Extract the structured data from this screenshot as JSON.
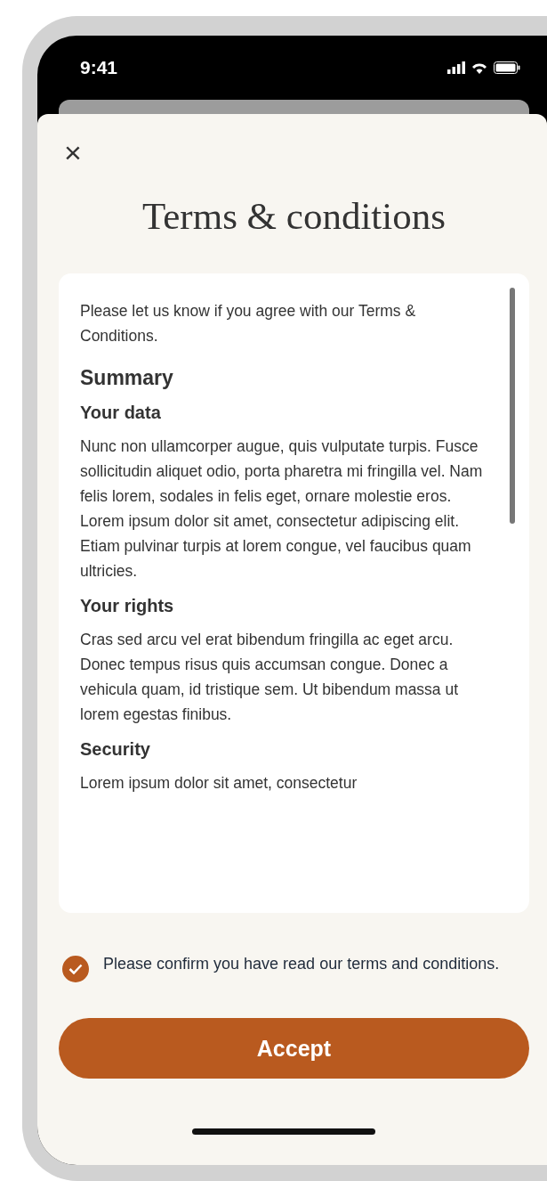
{
  "status_bar": {
    "time": "9:41"
  },
  "sheet": {
    "close": "×",
    "title": "Terms & conditions"
  },
  "terms": {
    "intro": "Please let us know if you agree with our Terms & Conditions.",
    "heading": "Summary",
    "sections": [
      {
        "title": "Your data",
        "paragraphs": [
          "Nunc non ullamcorper augue, quis vulputate turpis.  Fusce sollicitudin aliquet odio, porta pharetra mi fringilla vel. Nam felis lorem, sodales in felis eget, ornare molestie eros.",
          "Lorem ipsum dolor sit amet, consectetur adipiscing elit. Etiam pulvinar turpis at lorem congue, vel faucibus quam ultricies."
        ]
      },
      {
        "title": "Your rights",
        "paragraphs": [
          "Cras sed arcu vel erat bibendum fringilla ac eget arcu. Donec tempus risus quis accumsan congue. Donec a vehicula quam, id tristique sem. Ut bibendum massa ut lorem egestas finibus."
        ]
      },
      {
        "title": "Security",
        "paragraphs": [
          "Lorem ipsum dolor sit amet, consectetur"
        ]
      }
    ]
  },
  "confirm": {
    "label": "Please confirm you have read our terms and conditions.",
    "checked": true
  },
  "accept_button": "Accept"
}
